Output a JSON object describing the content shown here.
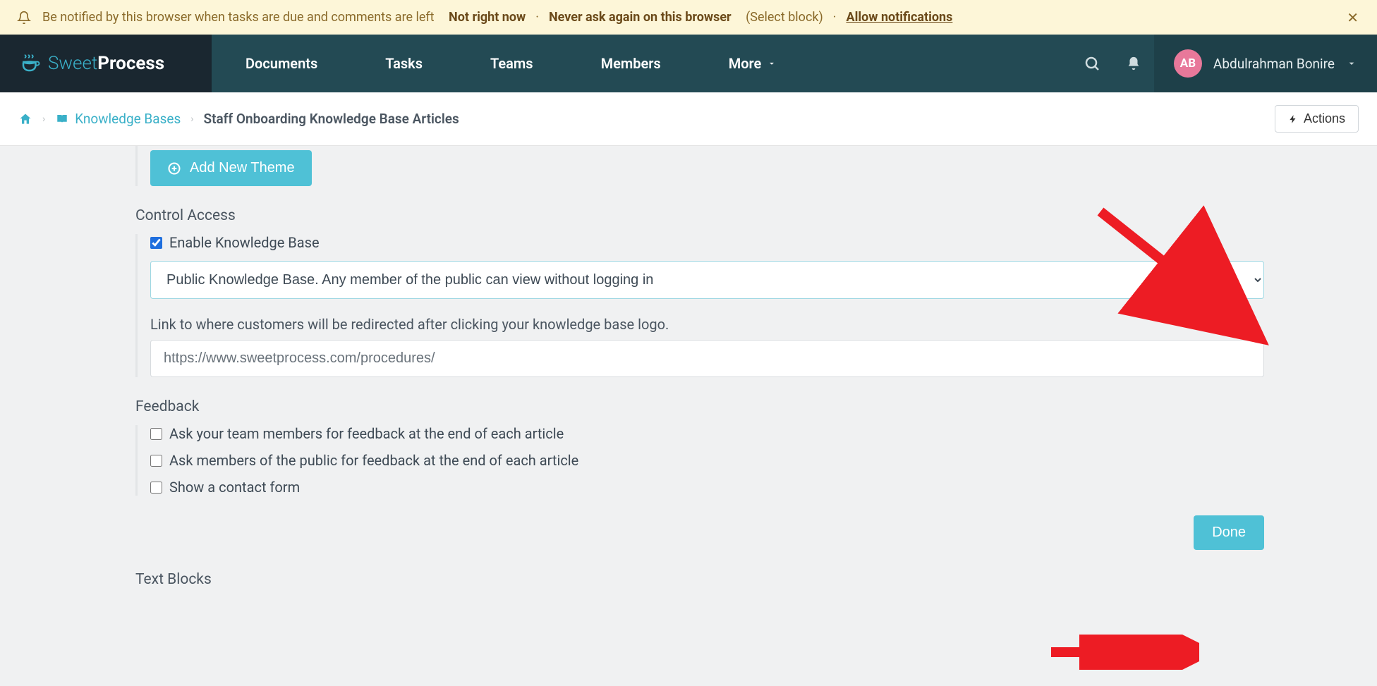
{
  "notif": {
    "message": "Be notified by this browser when tasks are due and comments are left",
    "not_now": "Not right now",
    "never": "Never ask again on this browser",
    "select_block": "(Select block)",
    "allow": "Allow notifications"
  },
  "logo": {
    "brand_thin": "Sweet",
    "brand_bold": "Process"
  },
  "nav": {
    "documents": "Documents",
    "tasks": "Tasks",
    "teams": "Teams",
    "members": "Members",
    "more": "More"
  },
  "user": {
    "initials": "AB",
    "name": "Abdulrahman Bonire"
  },
  "crumb": {
    "kb": "Knowledge Bases",
    "current": "Staff Onboarding Knowledge Base Articles",
    "actions": "Actions"
  },
  "buttons": {
    "add_theme": "Add New Theme",
    "done": "Done"
  },
  "sections": {
    "control_access": "Control Access",
    "feedback": "Feedback",
    "text_blocks": "Text Blocks"
  },
  "access": {
    "enable_label": "Enable Knowledge Base",
    "enable_checked": true,
    "select_value": "Public Knowledge Base. Any member of the public can view without logging in",
    "redirect_label": "Link to where customers will be redirected after clicking your knowledge base logo.",
    "redirect_value": "https://www.sweetprocess.com/procedures/"
  },
  "feedback": {
    "opt1": "Ask your team members for feedback at the end of each article",
    "opt2": "Ask members of the public for feedback at the end of each article",
    "opt3": "Show a contact form"
  },
  "colors": {
    "accent": "#4fc1d6",
    "nav_bg": "#234a54",
    "arrow": "#ed1c24"
  }
}
